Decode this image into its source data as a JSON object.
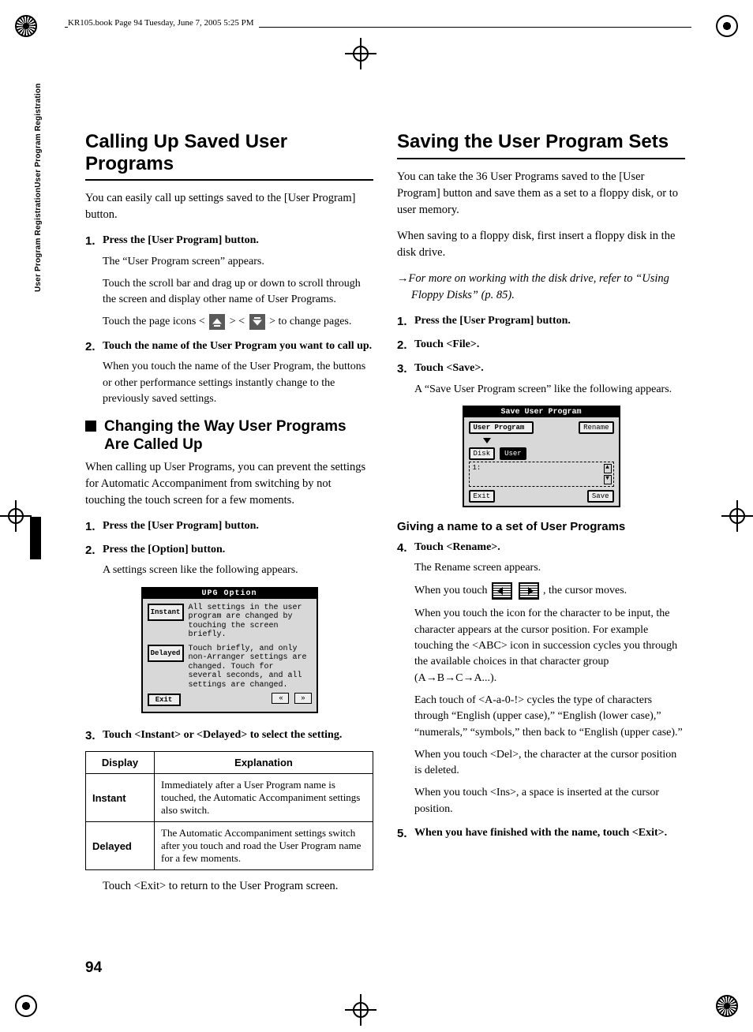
{
  "running_header": "KR105.book  Page 94  Tuesday, June 7, 2005  5:25 PM",
  "side_label": "User Program RegistrationUser Program Registration",
  "page_number": "94",
  "left": {
    "h1": "Calling Up Saved User Programs",
    "intro": "You can easily call up settings saved to the [User Program] button.",
    "step1_t": "Press the [User Program] button.",
    "step1_b1": "The “User Program screen” appears.",
    "step1_b2": "Touch the scroll bar and drag up or down to scroll through the screen and display other name of User Programs.",
    "step1_b3_a": "Touch the page icons < ",
    "step1_b3_b": " > < ",
    "step1_b3_c": " > to change pages.",
    "step2_t": "Touch the name of the User Program you want to call up.",
    "step2_b1": "When you touch the name of the User Program, the buttons or other performance settings instantly change to the previously saved settings.",
    "h2": "Changing the Way User Programs Are Called Up",
    "h2_intro": "When calling up User Programs, you can prevent the settings for Automatic Accompaniment from switching by not touching the touch screen for a few moments.",
    "h2_step1": "Press the [User Program] button.",
    "h2_step2": "Press the [Option] button.",
    "h2_step2_b": "A settings screen like the following appears.",
    "lcd_title": "UPG Option",
    "lcd_instant_btn": "Instant",
    "lcd_instant_txt": "All settings in the user program are changed by touching the screen briefly.",
    "lcd_delayed_btn": "Delayed",
    "lcd_delayed_txt": "Touch briefly, and only non-Arranger settings are changed. Touch for several seconds, and all settings are changed.",
    "lcd_exit": "Exit",
    "h2_step3": "Touch <Instant> or <Delayed> to select the setting.",
    "tbl_h1": "Display",
    "tbl_h2": "Explanation",
    "tbl_r1k": "Instant",
    "tbl_r1v": "Immediately after a User Program name is touched, the Automatic Accompaniment settings also switch.",
    "tbl_r2k": "Delayed",
    "tbl_r2v": "The Automatic Accompaniment settings switch after you touch and road the User Program name for a few moments.",
    "tbl_after": "Touch <Exit> to return to the User Program screen."
  },
  "right": {
    "h1": "Saving the User Program Sets",
    "p1": "You can take the 36 User Programs saved to the [User Program] button and save them as a set to a floppy disk, or to user memory.",
    "p2": "When saving to a floppy disk, first insert a floppy disk in the disk drive.",
    "xref": "For more on working with the disk drive, refer to “Using Floppy Disks” (p. 85).",
    "step1": "Press the [User Program] button.",
    "step2": "Touch <File>.",
    "step3": "Touch <Save>.",
    "step3_b": "A “Save User Program screen” like the following appears.",
    "lcd2_title": "Save User Program",
    "lcd2_field": "User Program",
    "lcd2_rename": "Rename",
    "lcd2_disk": "Disk",
    "lcd2_user": "User",
    "lcd2_slot": "1:",
    "lcd2_exit": "Exit",
    "lcd2_save": "Save",
    "h3": "Giving a name to a set of User Programs",
    "step4": "Touch <Rename>.",
    "step4_b1": "The Rename screen appears.",
    "step4_b2a": "When you touch ",
    "step4_b2b": ", the cursor moves.",
    "step4_b3": "When you touch the icon for the character to be input, the character appears at the cursor position. For example touching the <ABC> icon in succession cycles you through the available choices in that character group (A→B→C→A...).",
    "step4_b4": "Each touch of <A-a-0-!> cycles the type of characters through “English (upper case),” “English (lower case),” “numerals,” “symbols,” then back to “English (upper case).”",
    "step4_b5": "When you touch <Del>, the character at the cursor position is deleted.",
    "step4_b6": "When you touch <Ins>, a space is inserted at the cursor position.",
    "step5": "When you have finished with the name, touch <Exit>."
  }
}
